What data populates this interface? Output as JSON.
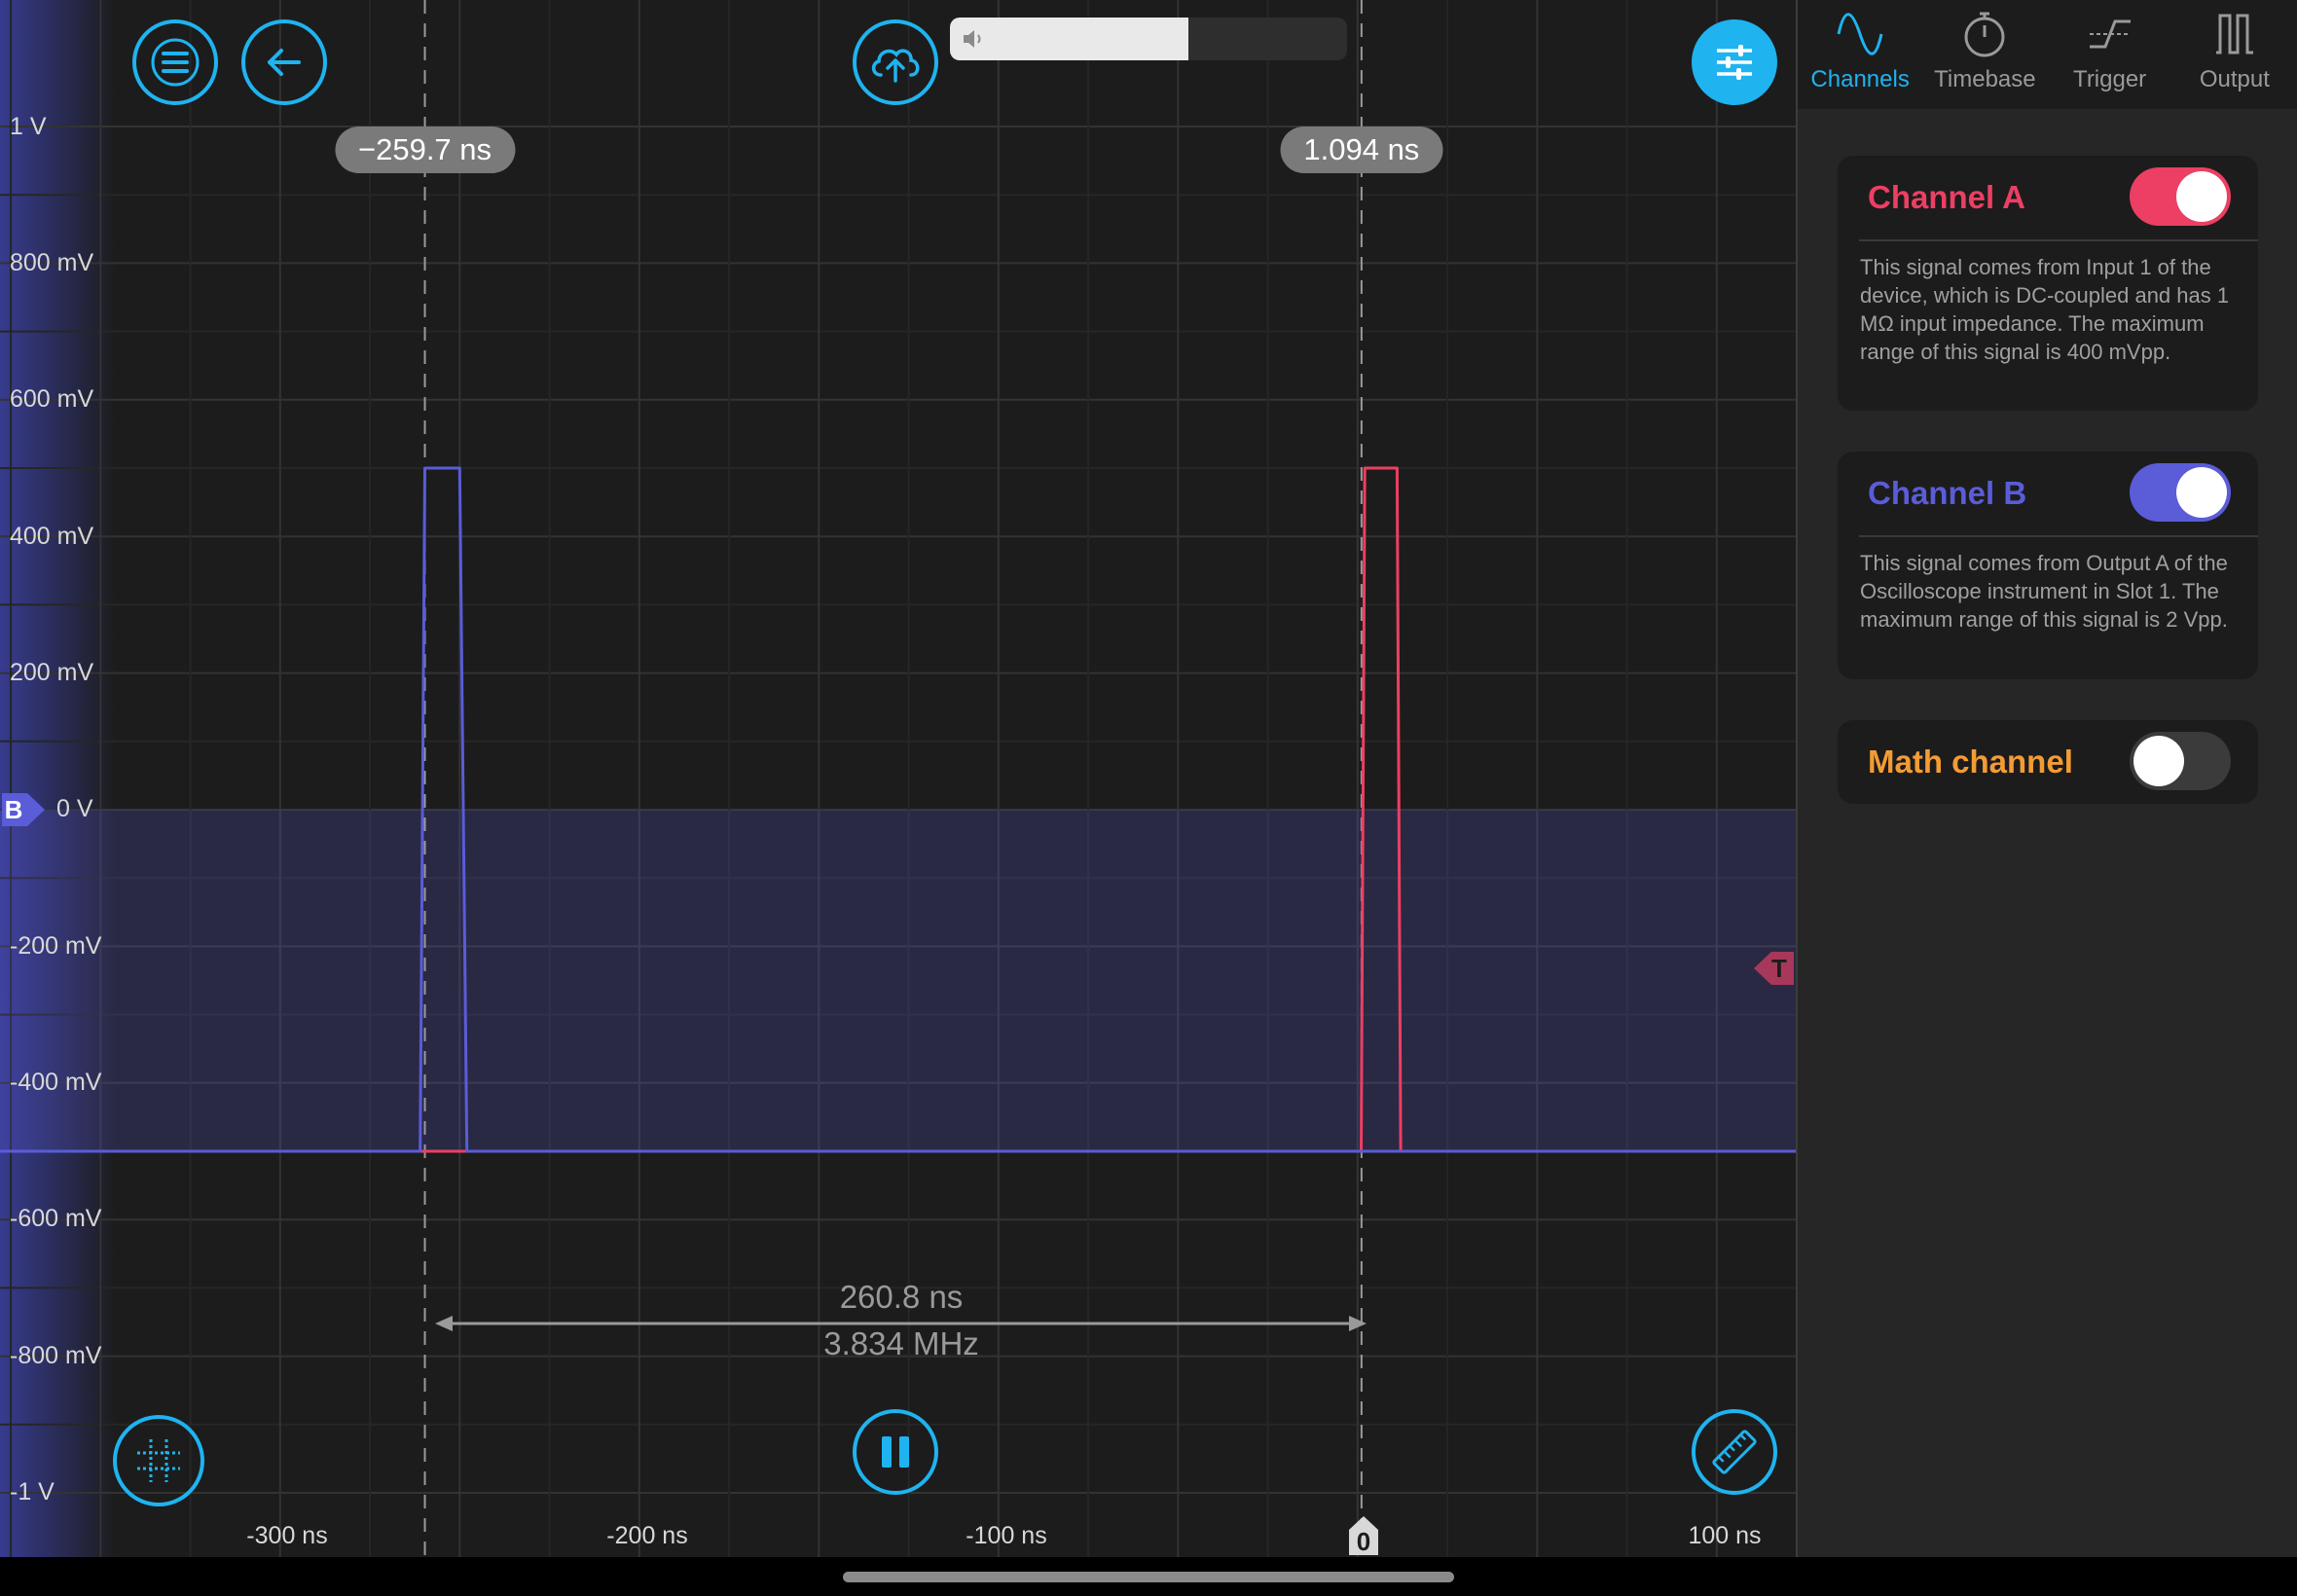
{
  "colors": {
    "accent": "#1fb3f0",
    "channel_a": "#ec3f63",
    "channel_b": "#5a5cd8",
    "math": "#f39c34"
  },
  "toolbar": {
    "menu_icon": "hamburger-icon",
    "back_icon": "arrow-left-icon",
    "upload_icon": "cloud-upload-icon",
    "settings_icon": "sliders-icon",
    "volume_icon": "speaker-icon",
    "volume_level": 0.6
  },
  "plot": {
    "y_labels": [
      "1 V",
      "800 mV",
      "600 mV",
      "400 mV",
      "200 mV",
      "0 V",
      "-200 mV",
      "-400 mV",
      "-600 mV",
      "-800 mV",
      "-1 V"
    ],
    "x_labels": [
      "-300 ns",
      "-200 ns",
      "-100 ns",
      "0",
      "100 ns"
    ],
    "cursor_1": "−259.7 ns",
    "cursor_2": "1.094 ns",
    "cursor_1_time_ns": -259.7,
    "cursor_2_time_ns": 1.094,
    "delta_time": "260.8 ns",
    "delta_freq": "3.834 MHz",
    "channel_b_marker": "B",
    "trigger_marker": "T",
    "zero_marker": "0"
  },
  "chart_data": {
    "type": "line",
    "xlim_ns": [
      -378,
      122
    ],
    "ylim_v": [
      -1,
      1
    ],
    "series": [
      {
        "name": "Channel A",
        "color": "#ec3f63",
        "x_ns": [
          -378,
          1,
          2,
          3,
          10,
          11,
          12,
          122
        ],
        "y_v": [
          -0.5,
          -0.5,
          0.5,
          0.5,
          0.5,
          0.5,
          -0.5,
          -0.5
        ]
      },
      {
        "name": "Channel B",
        "color": "#5a5cd8",
        "x_ns": [
          -378,
          -261,
          -259.7,
          -252,
          -250,
          -248,
          1,
          2,
          12,
          122
        ],
        "y_v": [
          -0.5,
          -0.5,
          0.5,
          0.5,
          0.5,
          -0.5,
          -0.5,
          -0.5,
          -0.5,
          -0.5
        ]
      }
    ]
  },
  "bottom": {
    "grid_icon": "grid-crosshair-icon",
    "pause_icon": "pause-icon",
    "ruler_icon": "ruler-icon"
  },
  "tabs": [
    {
      "label": "Channels",
      "icon": "sine-wave-icon",
      "active": true
    },
    {
      "label": "Timebase",
      "icon": "stopwatch-icon",
      "active": false
    },
    {
      "label": "Trigger",
      "icon": "trigger-edge-icon",
      "active": false
    },
    {
      "label": "Output",
      "icon": "pulse-wave-icon",
      "active": false
    }
  ],
  "channels": [
    {
      "title": "Channel A",
      "desc": "This signal comes from Input 1 of the device, which is DC-coupled and has 1 MΩ input impedance. The maximum range of this signal is 400 mVpp.",
      "on": true
    },
    {
      "title": "Channel B",
      "desc": "This signal comes from Output A of the Oscilloscope instrument in Slot 1. The maximum range of this signal is 2 Vpp.",
      "on": true
    },
    {
      "title": "Math channel",
      "desc": "",
      "on": false
    }
  ]
}
